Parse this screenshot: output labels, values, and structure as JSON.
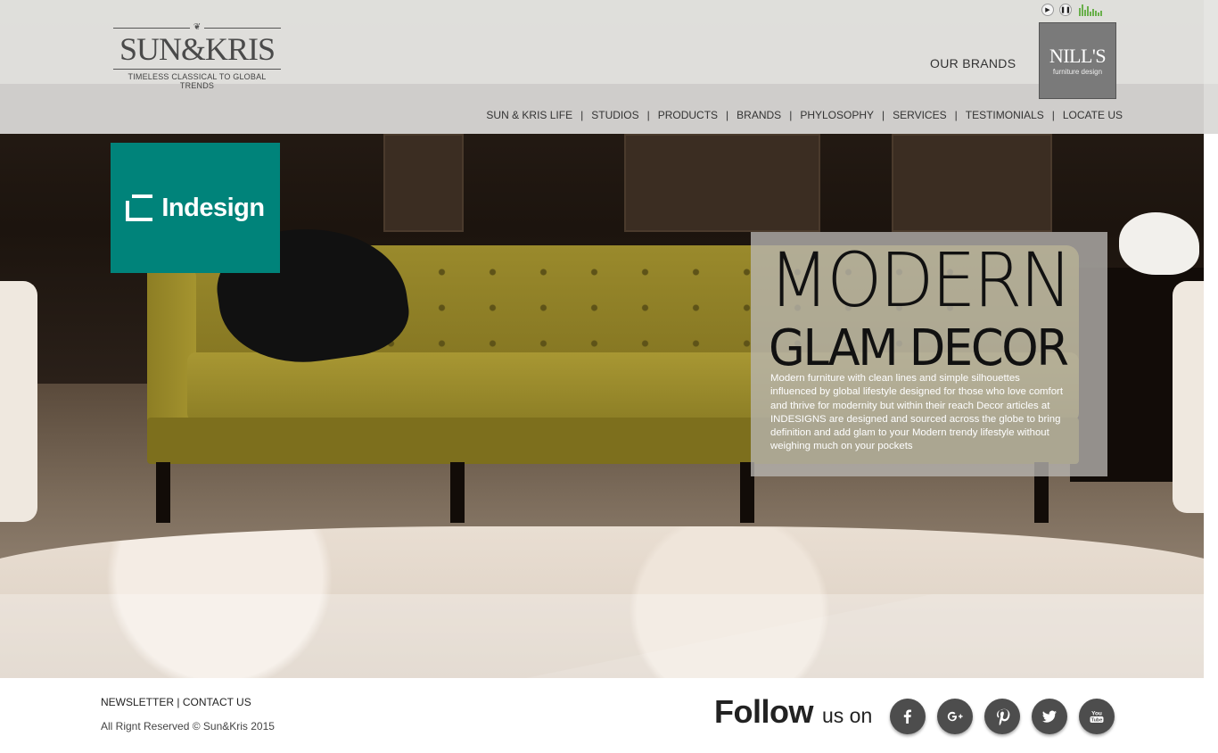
{
  "header": {
    "logo": {
      "name": "SUN&KRIS",
      "tagline": "TIMELESS CLASSICAL TO GLOBAL TRENDS"
    },
    "our_brands_label": "OUR BRANDS",
    "brand_badge": {
      "name": "NILL'S",
      "sub": "furniture design"
    },
    "player": {
      "play_icon": "play-icon",
      "pause_icon": "pause-icon",
      "equalizer_icon": "equalizer-icon"
    },
    "nav": [
      "SUN & KRIS LIFE",
      "STUDIOS",
      "PRODUCTS",
      "BRANDS",
      "PHYLOSOPHY",
      "SERVICES",
      "TESTIMONIALS",
      "LOCATE US"
    ]
  },
  "hero": {
    "brand_tile": {
      "name": "Indesign",
      "color": "#00837a"
    },
    "heading_line1": "MODERN",
    "heading_line2": "GLAM DECOR",
    "description": "Modern furniture with clean lines and simple silhouettes influenced by global lifestyle designed for those who love comfort and thrive for modernity but within their reach Decor articles at INDESIGNS are designed and sourced across the globe  to bring definition and add glam to your Modern trendy lifestyle without weighing much on your pockets"
  },
  "footer": {
    "newsletter": "NEWSLETTER",
    "separator": "|",
    "contact": "CONTACT US",
    "copyright": "All Rignt Reserved © Sun&Kris 2015",
    "follow_big": "Follow",
    "follow_small": "us on",
    "socials": [
      "facebook-icon",
      "google-plus-icon",
      "pinterest-icon",
      "twitter-icon",
      "youtube-icon"
    ]
  }
}
